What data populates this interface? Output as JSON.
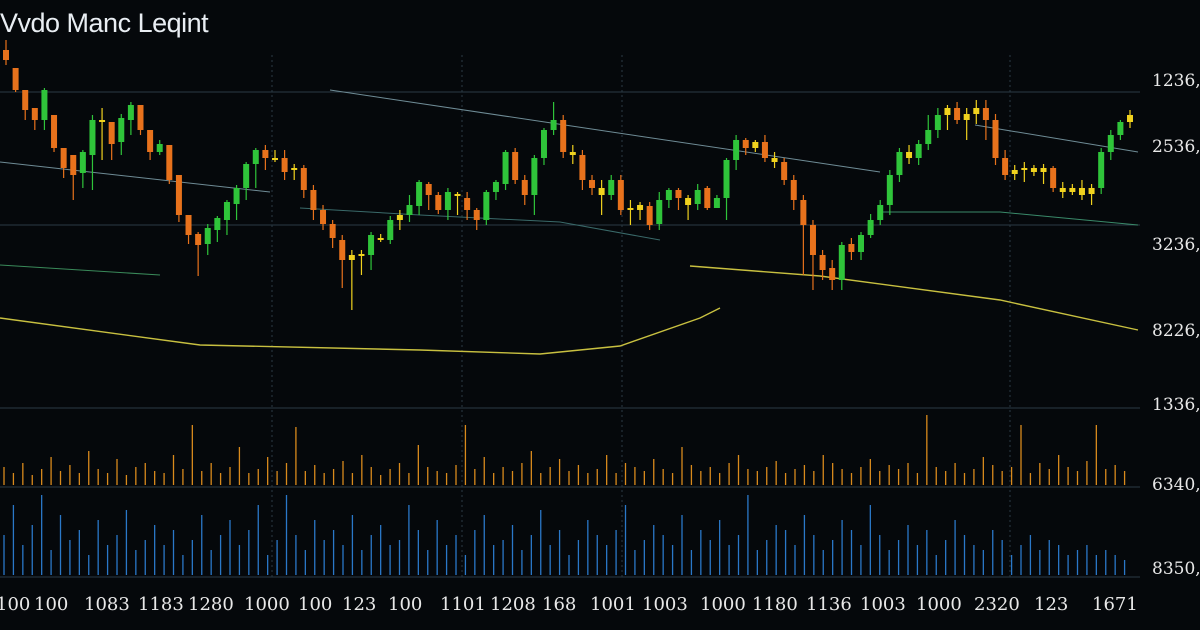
{
  "title": "Vvdo Manc Leqint",
  "colors": {
    "background": "#05080b",
    "grid": "#2a3a44",
    "bullish": "#2fc43a",
    "bearish": "#e8721c",
    "neutral": "#f0d21e",
    "ma_yellow": "#c8c040",
    "ma_green": "#55b640",
    "trend_line": "#6f8c96",
    "volume_orange": "#d98a1c",
    "volume_blue": "#2a78c8",
    "axis_text": "#e8e8e8"
  },
  "chart_data": {
    "type": "candlestick",
    "title": "Vvdo Manc Leqint",
    "y_axis_labels": [
      "1236,00",
      "2536,00",
      "3236,00",
      "8226,00",
      "1336,00",
      "6340,00",
      "8350,00"
    ],
    "x_axis_labels": [
      "100",
      "100",
      "1083",
      "1183",
      "1280",
      "1000",
      "100",
      "123",
      "100",
      "1101",
      "1208",
      "168",
      "1001",
      "1003",
      "1000",
      "1180",
      "1136",
      "1003",
      "1000",
      "2320",
      "123",
      "1671"
    ],
    "grid": true,
    "candles_ohlc": [
      [
        370,
        360,
        380,
        355
      ],
      [
        352,
        330,
        350,
        328
      ],
      [
        330,
        310,
        320,
        300
      ],
      [
        312,
        300,
        306,
        290
      ],
      [
        300,
        330,
        332,
        290
      ],
      [
        305,
        272,
        300,
        268
      ],
      [
        272,
        252,
        270,
        242
      ],
      [
        265,
        245,
        248,
        220
      ],
      [
        247,
        268,
        270,
        232
      ],
      [
        265,
        300,
        305,
        230
      ],
      [
        300,
        300,
        312,
        260
      ],
      [
        298,
        276,
        290,
        260
      ],
      [
        278,
        302,
        306,
        265
      ],
      [
        300,
        315,
        318,
        285
      ],
      [
        315,
        290,
        310,
        285
      ],
      [
        290,
        268,
        280,
        260
      ],
      [
        268,
        276,
        280,
        265
      ],
      [
        275,
        240,
        274,
        236
      ],
      [
        245,
        205,
        242,
        198
      ],
      [
        205,
        185,
        200,
        176
      ],
      [
        186,
        175,
        188,
        144
      ],
      [
        176,
        192,
        196,
        165
      ],
      [
        190,
        202,
        204,
        178
      ],
      [
        200,
        218,
        220,
        185
      ],
      [
        216,
        232,
        235,
        200
      ],
      [
        232,
        256,
        258,
        220
      ],
      [
        256,
        270,
        272,
        232
      ],
      [
        270,
        262,
        275,
        250
      ],
      [
        260,
        262,
        270,
        258
      ],
      [
        262,
        248,
        270,
        240
      ],
      [
        250,
        252,
        256,
        240
      ],
      [
        252,
        230,
        255,
        222
      ],
      [
        230,
        210,
        235,
        200
      ],
      [
        210,
        196,
        215,
        190
      ],
      [
        196,
        182,
        200,
        172
      ],
      [
        180,
        160,
        185,
        132
      ],
      [
        160,
        165,
        170,
        110
      ],
      [
        166,
        165,
        170,
        145
      ],
      [
        165,
        185,
        188,
        150
      ],
      [
        182,
        180,
        186,
        178
      ],
      [
        180,
        200,
        204,
        176
      ],
      [
        200,
        205,
        210,
        190
      ],
      [
        205,
        215,
        225,
        198
      ],
      [
        214,
        238,
        240,
        205
      ],
      [
        236,
        225,
        238,
        210
      ],
      [
        225,
        210,
        228,
        206
      ],
      [
        210,
        228,
        232,
        200
      ],
      [
        226,
        224,
        228,
        205
      ],
      [
        222,
        210,
        228,
        200
      ],
      [
        210,
        200,
        212,
        190
      ],
      [
        200,
        228,
        230,
        195
      ],
      [
        228,
        238,
        240,
        220
      ],
      [
        236,
        268,
        270,
        230
      ],
      [
        268,
        240,
        272,
        236
      ],
      [
        240,
        225,
        245,
        215
      ],
      [
        225,
        262,
        265,
        205
      ],
      [
        262,
        290,
        292,
        255
      ],
      [
        290,
        300,
        318,
        285
      ],
      [
        300,
        268,
        305,
        262
      ],
      [
        268,
        265,
        275,
        256
      ],
      [
        265,
        240,
        270,
        230
      ],
      [
        240,
        232,
        245,
        225
      ],
      [
        232,
        225,
        240,
        205
      ],
      [
        225,
        240,
        245,
        220
      ],
      [
        240,
        210,
        245,
        205
      ],
      [
        212,
        210,
        220,
        195
      ],
      [
        210,
        215,
        218,
        200
      ],
      [
        214,
        195,
        218,
        190
      ],
      [
        196,
        220,
        228,
        190
      ],
      [
        220,
        230,
        232,
        212
      ],
      [
        230,
        222,
        232,
        210
      ],
      [
        222,
        215,
        225,
        200
      ],
      [
        216,
        230,
        236,
        210
      ],
      [
        232,
        212,
        234,
        210
      ],
      [
        212,
        222,
        225,
        215
      ],
      [
        222,
        260,
        262,
        200
      ],
      [
        260,
        280,
        285,
        250
      ],
      [
        280,
        272,
        282,
        265
      ],
      [
        272,
        278,
        280,
        268
      ],
      [
        278,
        262,
        285,
        258
      ],
      [
        262,
        258,
        268,
        252
      ],
      [
        258,
        240,
        262,
        235
      ],
      [
        240,
        220,
        245,
        210
      ],
      [
        220,
        195,
        225,
        145
      ],
      [
        195,
        165,
        200,
        130
      ],
      [
        165,
        150,
        170,
        140
      ],
      [
        152,
        140,
        160,
        130
      ],
      [
        140,
        175,
        178,
        130
      ],
      [
        176,
        168,
        182,
        160
      ],
      [
        168,
        185,
        188,
        160
      ],
      [
        185,
        200,
        206,
        182
      ],
      [
        200,
        215,
        220,
        195
      ],
      [
        215,
        245,
        250,
        205
      ],
      [
        245,
        268,
        272,
        238
      ],
      [
        268,
        262,
        275,
        256
      ],
      [
        262,
        276,
        280,
        255
      ],
      [
        276,
        290,
        305,
        270
      ],
      [
        290,
        305,
        312,
        282
      ],
      [
        305,
        312,
        315,
        290
      ],
      [
        312,
        300,
        318,
        296
      ],
      [
        300,
        306,
        312,
        280
      ],
      [
        306,
        312,
        320,
        296
      ],
      [
        312,
        300,
        320,
        280
      ],
      [
        300,
        262,
        306,
        255
      ],
      [
        262,
        245,
        270,
        240
      ],
      [
        246,
        250,
        255,
        240
      ],
      [
        250,
        252,
        258,
        238
      ],
      [
        252,
        248,
        255,
        244
      ],
      [
        248,
        252,
        256,
        236
      ],
      [
        252,
        232,
        254,
        228
      ],
      [
        232,
        228,
        238,
        222
      ],
      [
        228,
        232,
        236,
        225
      ],
      [
        232,
        225,
        240,
        220
      ],
      [
        226,
        232,
        236,
        215
      ],
      [
        232,
        268,
        272,
        226
      ],
      [
        268,
        285,
        290,
        260
      ],
      [
        285,
        298,
        300,
        280
      ],
      [
        298,
        305,
        310,
        292
      ]
    ],
    "volume_orange": [
      18,
      12,
      22,
      10,
      16,
      28,
      14,
      20,
      12,
      34,
      16,
      12,
      26,
      10,
      18,
      22,
      14,
      12,
      30,
      16,
      60,
      14,
      22,
      12,
      18,
      38,
      12,
      16,
      28,
      14,
      22,
      58,
      14,
      20,
      12,
      16,
      24,
      12,
      30,
      18,
      10,
      16,
      22,
      12,
      40,
      18,
      14,
      12,
      20,
      60,
      16,
      28,
      12,
      18,
      14,
      22,
      34,
      12,
      18,
      26,
      14,
      20,
      12,
      16,
      30,
      12,
      22,
      18,
      14,
      26,
      16,
      12,
      38,
      20,
      14,
      18,
      12,
      22,
      30,
      16,
      14,
      18,
      24,
      12,
      16,
      20,
      14,
      30,
      22,
      16,
      12,
      18,
      26,
      14,
      20,
      16,
      22,
      12,
      70,
      18,
      14,
      22,
      12,
      16,
      28,
      20,
      14,
      18,
      60,
      12,
      22,
      16,
      30,
      18,
      14,
      24,
      60,
      16,
      20,
      14
    ],
    "volume_blue": [
      40,
      70,
      30,
      50,
      80,
      25,
      60,
      35,
      45,
      20,
      55,
      30,
      40,
      65,
      25,
      35,
      50,
      30,
      45,
      20,
      35,
      60,
      25,
      40,
      55,
      30,
      45,
      70,
      20,
      35,
      80,
      40,
      25,
      55,
      35,
      45,
      30,
      60,
      25,
      40,
      50,
      30,
      35,
      70,
      45,
      25,
      55,
      30,
      40,
      20,
      45,
      60,
      30,
      35,
      50,
      25,
      40,
      65,
      30,
      45,
      20,
      35,
      55,
      40,
      30,
      45,
      70,
      25,
      35,
      50,
      40,
      30,
      60,
      25,
      45,
      35,
      55,
      30,
      40,
      80,
      25,
      35,
      50,
      45,
      30,
      60,
      40,
      25,
      35,
      55,
      45,
      30,
      70,
      40,
      25,
      35,
      50,
      30,
      45,
      20,
      35,
      55,
      40,
      30,
      25,
      45,
      35,
      20,
      30,
      40,
      25,
      35,
      30,
      20,
      25,
      30,
      20,
      25,
      20,
      15
    ]
  }
}
